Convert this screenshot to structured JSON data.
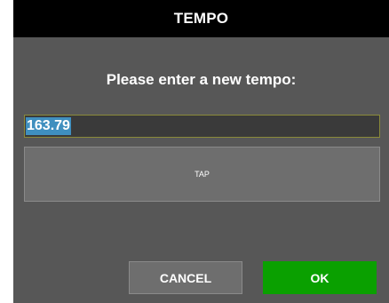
{
  "dialog": {
    "title": "TEMPO",
    "prompt": "Please enter a new tempo:",
    "tempo_value": "163.79",
    "tap_label": "TAP",
    "cancel_label": "CANCEL",
    "ok_label": "OK"
  },
  "colors": {
    "dialog_background": "#575757",
    "title_bar": "#000000",
    "input_selection": "#3f8fbf",
    "ok_button": "#0aa000",
    "neutral_button": "#6e6e6e"
  }
}
